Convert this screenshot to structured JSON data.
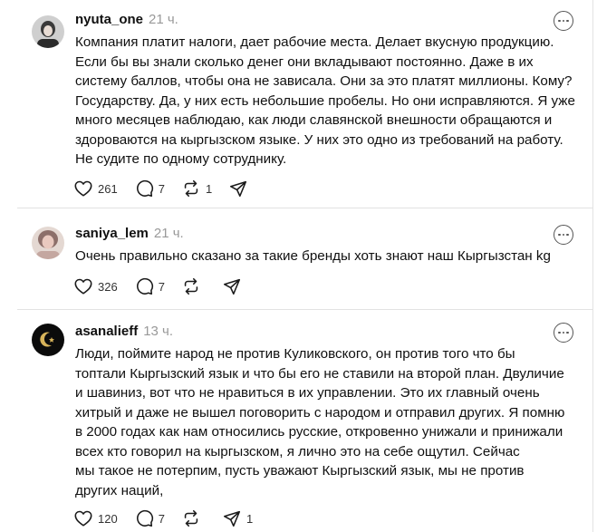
{
  "posts": [
    {
      "username": "nyuta_one",
      "time": "21 ч.",
      "text": "Компания платит налоги, дает рабочие места. Делает вкусную продукцию.\nЕсли бы вы знали сколько денег они вкладывают постоянно. Даже в их\nсистему баллов, чтобы она не зависала. Они за это платят миллионы. Кому?\nГосударству. Да, у них есть небольшие пробелы. Но они исправляются. Я уже\nмного месяцев наблюдаю, как люди славянской внешности обращаются и\nздороваются на кыргызском языке. У них это одно из требований на работу.\nНе судите по одному сотруднику.",
      "likes": "261",
      "replies": "7",
      "reposts": "1",
      "shares": ""
    },
    {
      "username": "saniya_lem",
      "time": "21 ч.",
      "text": "Очень правильно сказано за такие бренды хоть знают наш Кыргызстан kg",
      "likes": "326",
      "replies": "7",
      "reposts": "",
      "shares": ""
    },
    {
      "username": "asanalieff",
      "time": "13 ч.",
      "text": "Люди, поймите народ не против Куликовского, он против того что бы\nтоптали Кыргызский язык и что бы его не ставили на второй план. Двуличие\nи шавиниз, вот что не нравиться в их управлении. Это их главный очень\nхитрый и даже не вышел поговорить с народом и отправил других. Я помню\nв 2000 годах как нам относились русские, откровенно унижали и принижали\nвсех кто говорил на кыргызском, я лично это на себе ощутил. Сейчас\nмы такое не потерпим, пусть уважают Кыргызский язык, мы не против\nдругих наций,",
      "likes": "120",
      "replies": "7",
      "reposts": "",
      "shares": "1"
    }
  ]
}
